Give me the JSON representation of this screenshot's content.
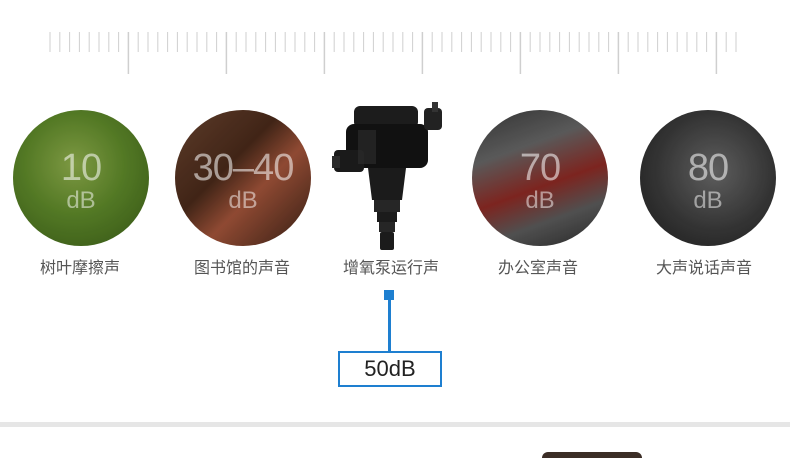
{
  "ruler": {
    "major_ticks": 7,
    "minor_per_major": 10
  },
  "levels": [
    {
      "value": "10",
      "unit": "dB",
      "label": "树叶摩擦声"
    },
    {
      "value": "30–40",
      "unit": "dB",
      "label": "图书馆的声音"
    },
    {
      "value": "",
      "unit": "",
      "label": "增氧泵运行声"
    },
    {
      "value": "70",
      "unit": "dB",
      "label": "办公室声音"
    },
    {
      "value": "80",
      "unit": "dB",
      "label": "大声说话声音"
    }
  ],
  "product": {
    "noise_value": "50dB"
  },
  "colors": {
    "accent": "#1e7fd0",
    "label_text": "#555555"
  }
}
